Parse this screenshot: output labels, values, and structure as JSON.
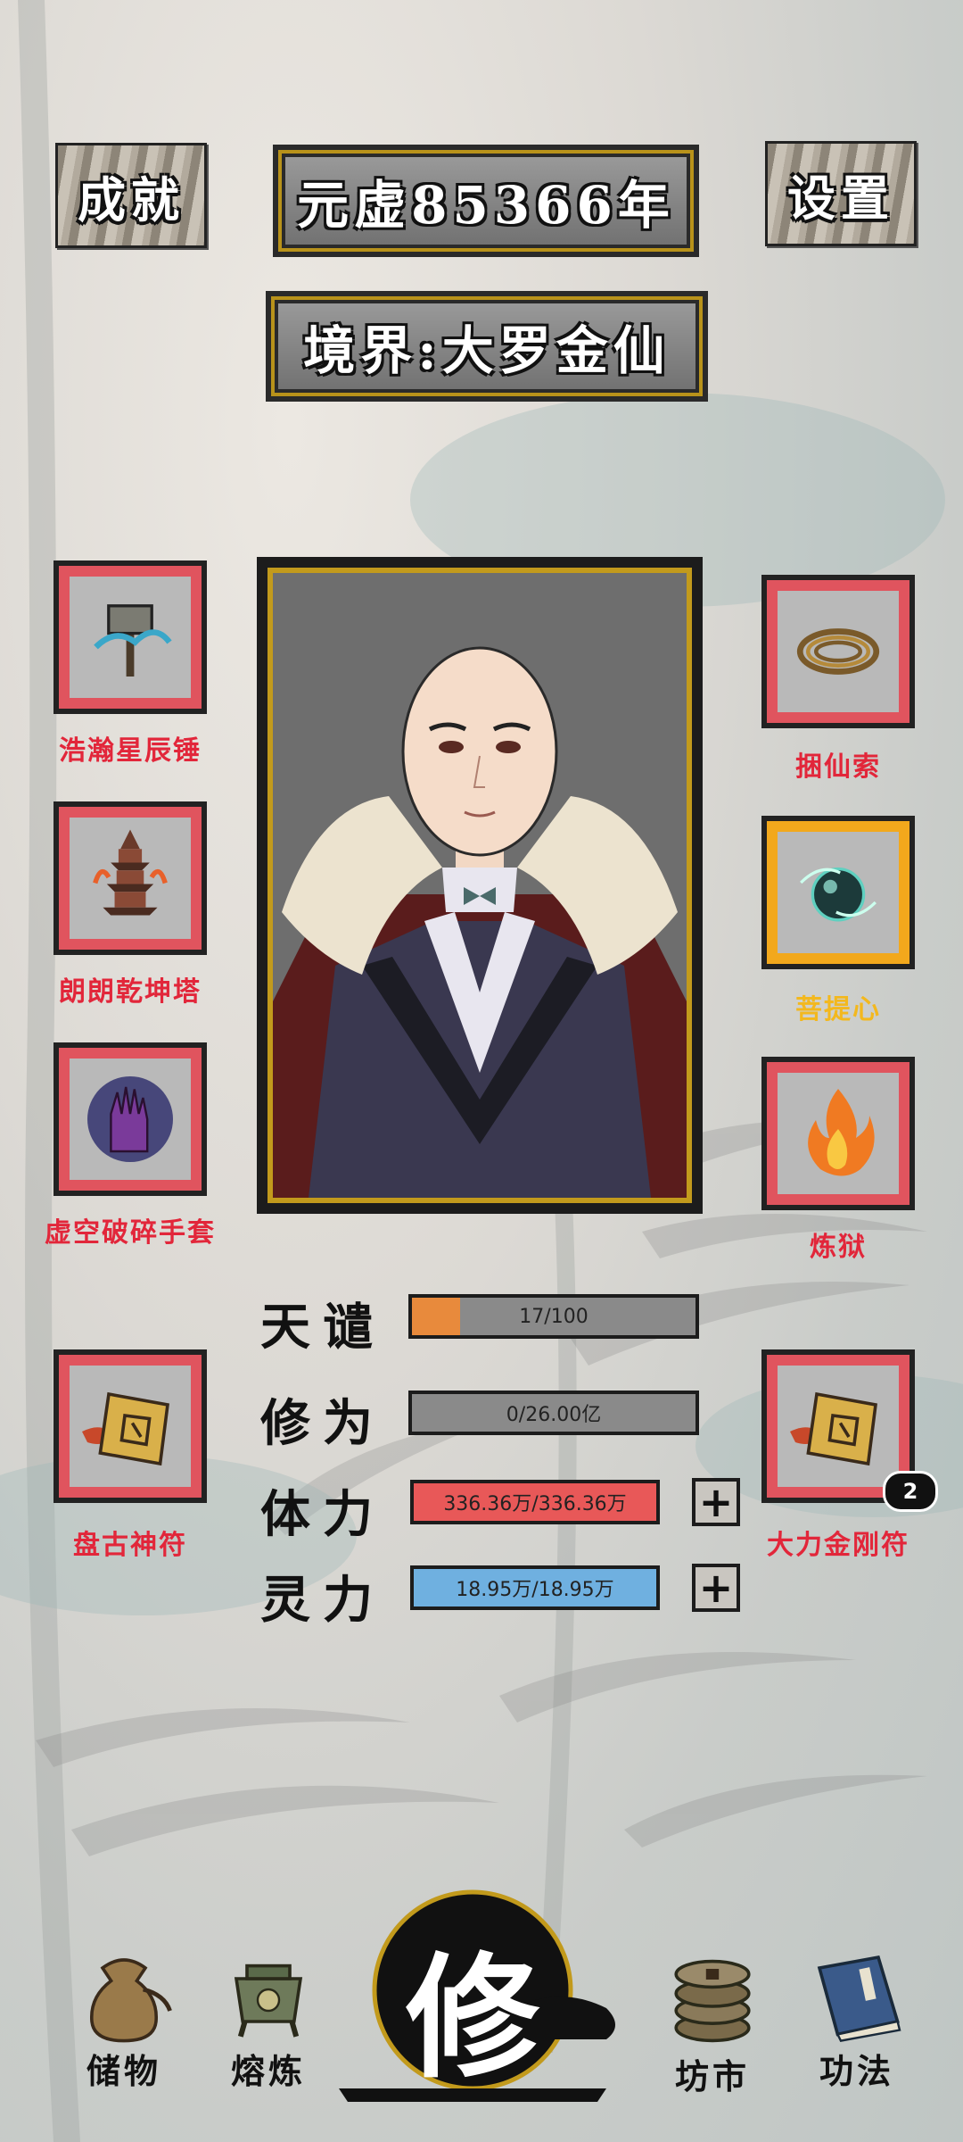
{
  "header": {
    "achievements_label": "成就",
    "year_label": "元虚85366年",
    "settings_label": "设置",
    "realm_label": "境界:大罗金仙"
  },
  "left_items": [
    {
      "name": "浩瀚星辰锤",
      "icon": "hammer-icon"
    },
    {
      "name": "朗朗乾坤塔",
      "icon": "pagoda-icon"
    },
    {
      "name": "虚空破碎手套",
      "icon": "gauntlet-icon"
    },
    {
      "name": "盘古神符",
      "icon": "talisman-icon"
    }
  ],
  "right_items": [
    {
      "name": "捆仙索",
      "icon": "rope-icon"
    },
    {
      "name": "菩提心",
      "icon": "orb-icon",
      "highlight": "gold"
    },
    {
      "name": "炼狱",
      "icon": "flame-icon"
    },
    {
      "name": "大力金刚符",
      "icon": "talisman-icon",
      "badge": "2"
    }
  ],
  "stats": {
    "tribulation": {
      "label": "天谴",
      "text": "17/100",
      "fraction": 0.17,
      "color": "#e88a3c"
    },
    "cultivation": {
      "label": "修为",
      "text": "0/26.00亿",
      "fraction": 0,
      "color": "#8a8a8a"
    },
    "stamina": {
      "label": "体力",
      "text": "336.36万/336.36万",
      "fraction": 1,
      "color": "#e85858"
    },
    "spirit": {
      "label": "灵力",
      "text": "18.95万/18.95万",
      "fraction": 1,
      "color": "#6fb0e0"
    }
  },
  "nav": {
    "storage": "储物",
    "smelt": "熔炼",
    "cultivate": "修",
    "market": "坊市",
    "skills": "功法"
  },
  "colors": {
    "slot_border": "#e0545e",
    "slot_border_gold": "#f2a81c",
    "label_red": "#e2263a",
    "label_gold": "#f3b81e",
    "frame_gold": "#c29a1c"
  }
}
